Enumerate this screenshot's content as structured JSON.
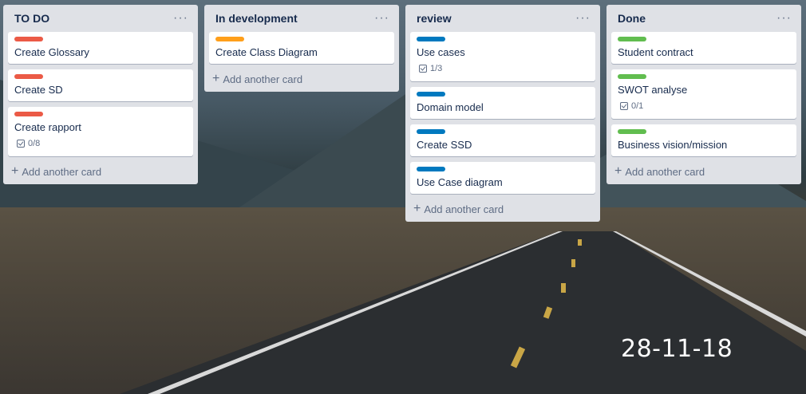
{
  "lists": [
    {
      "title": "TO DO",
      "menu": "···",
      "add_card": "Add another card",
      "cards": [
        {
          "title": "Create Glossary",
          "label_color": "#eb5a46"
        },
        {
          "title": "Create SD",
          "label_color": "#eb5a46"
        },
        {
          "title": "Create rapport",
          "label_color": "#eb5a46",
          "checklist": "0/8"
        }
      ]
    },
    {
      "title": "In development",
      "menu": "···",
      "add_card": "Add another card",
      "cards": [
        {
          "title": "Create Class Diagram",
          "label_color": "#ff9f1a"
        }
      ]
    },
    {
      "title": "review",
      "menu": "···",
      "add_card": "Add another card",
      "cards": [
        {
          "title": "Use cases",
          "label_color": "#0079bf",
          "checklist": "1/3"
        },
        {
          "title": "Domain model",
          "label_color": "#0079bf"
        },
        {
          "title": "Create SSD",
          "label_color": "#0079bf"
        },
        {
          "title": "Use Case diagram",
          "label_color": "#0079bf"
        }
      ]
    },
    {
      "title": "Done",
      "menu": "···",
      "add_card": "Add another card",
      "cards": [
        {
          "title": "Student contract",
          "label_color": "#61bd4f"
        },
        {
          "title": "SWOT analyse",
          "label_color": "#61bd4f",
          "checklist": "0/1"
        },
        {
          "title": "Business vision/mission",
          "label_color": "#61bd4f"
        }
      ]
    }
  ],
  "date_stamp": "28-11-18",
  "icons": {
    "add": "plus-icon",
    "checklist": "checklist-icon",
    "menu": "more-icon"
  }
}
